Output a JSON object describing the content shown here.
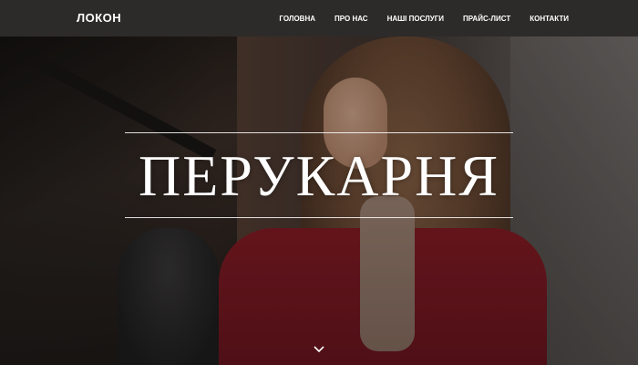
{
  "navbar": {
    "brand": "ЛОКОН",
    "items": [
      {
        "label": "ГОЛОВНА"
      },
      {
        "label": "ПРО НАС"
      },
      {
        "label": "НАШІ ПОСЛУГИ"
      },
      {
        "label": "ПРАЙС-ЛИСТ"
      },
      {
        "label": "КОНТАКТИ"
      }
    ]
  },
  "hero": {
    "title": "ПЕРУКАРНЯ",
    "scroll_icon": "chevron-down-icon"
  },
  "colors": {
    "navbar_bg": "#2d2b29",
    "text": "#ffffff",
    "coat_accent": "#8a1d26"
  }
}
